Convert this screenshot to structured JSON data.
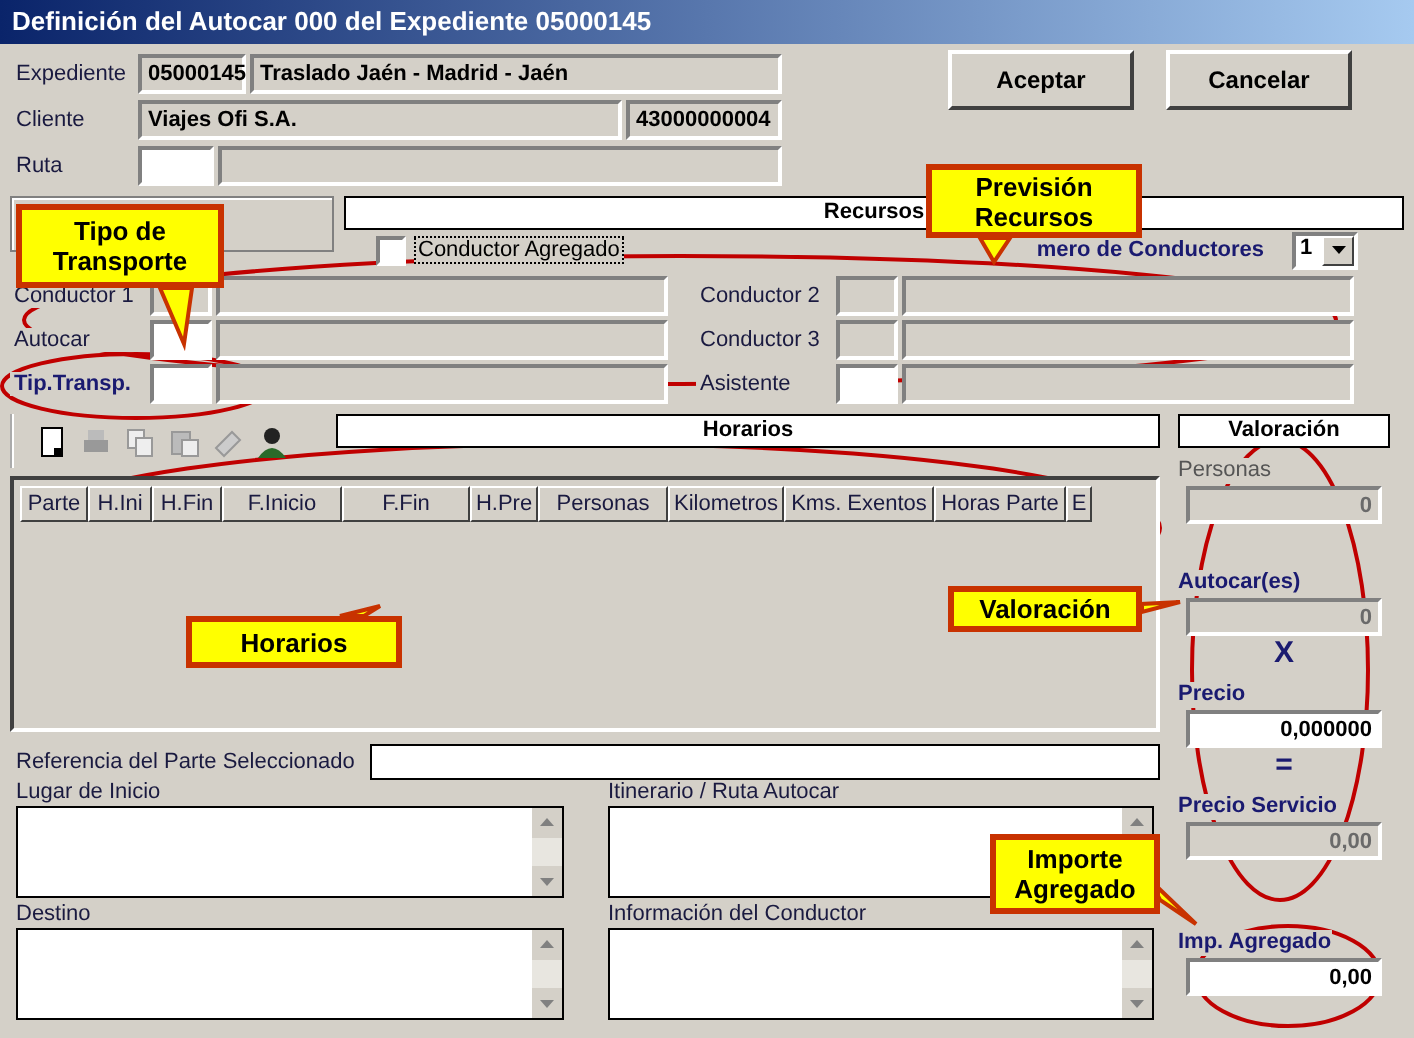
{
  "window": {
    "title": "Definición del Autocar 000 del Expediente 05000145"
  },
  "buttons": [
    {
      "label": "Aceptar"
    },
    {
      "label": "Cancelar"
    }
  ],
  "header": {
    "expediente": {
      "label": "Expediente",
      "code": "05000145",
      "description": "Traslado Jaén - Madrid - Jaén"
    },
    "cliente": {
      "label": "Cliente",
      "name": "Viajes Ofi S.A.",
      "code": "43000000004"
    },
    "ruta": {
      "label": "Ruta"
    }
  },
  "recursos": {
    "title": "Recursos",
    "conductor_agregado": {
      "label": "Conductor  Agregado",
      "checked": false
    },
    "numero_conductores": {
      "label": "mero de Conductores",
      "value": "1"
    },
    "left_fields": [
      {
        "label": "Conductor 1",
        "bold": false,
        "editable": false
      },
      {
        "label": "Autocar",
        "bold": false,
        "editable": true
      },
      {
        "label": "Tip.Transp.",
        "bold": true,
        "editable": true
      }
    ],
    "right_fields": [
      {
        "label": "Conductor 2",
        "bold": false,
        "editable": false
      },
      {
        "label": "Conductor 3",
        "bold": false,
        "editable": false
      },
      {
        "label": "Asistente",
        "bold": false,
        "editable": true
      }
    ]
  },
  "horarios": {
    "title": "Horarios",
    "columns": [
      "Parte",
      "H.Ini",
      "H.Fin",
      "F.Inicio",
      "F.Fin",
      "H.Pre",
      "Personas",
      "Kilometros",
      "Kms. Exentos",
      "Horas Parte",
      "E"
    ]
  },
  "referencia": {
    "label": "Referencia del Parte Seleccionado"
  },
  "text_areas": [
    {
      "label": "Lugar de Inicio"
    },
    {
      "label": "Itinerario / Ruta Autocar"
    },
    {
      "label": "Destino"
    },
    {
      "label": "Información del Conductor"
    }
  ],
  "valoracion": {
    "title": "Valoración",
    "fields": [
      {
        "label": "Personas",
        "value": "0",
        "bold": false,
        "editable": false
      },
      {
        "label": "Autocar(es)",
        "value": "0",
        "bold": true,
        "editable": false
      },
      {
        "label": "Precio",
        "value": "0,000000",
        "bold": true,
        "editable": true
      },
      {
        "label": "Precio Servicio",
        "value": "0,00",
        "bold": true,
        "editable": false
      },
      {
        "label": "Imp. Agregado",
        "value": "0,00",
        "bold": true,
        "editable": true
      }
    ],
    "times": "X",
    "equals": "="
  },
  "annotations": [
    {
      "text": "Tipo de Transporte"
    },
    {
      "text": "Previsión Recursos"
    },
    {
      "text": "Horarios"
    },
    {
      "text": "Valoración"
    },
    {
      "text": "Importe Agregado"
    }
  ]
}
